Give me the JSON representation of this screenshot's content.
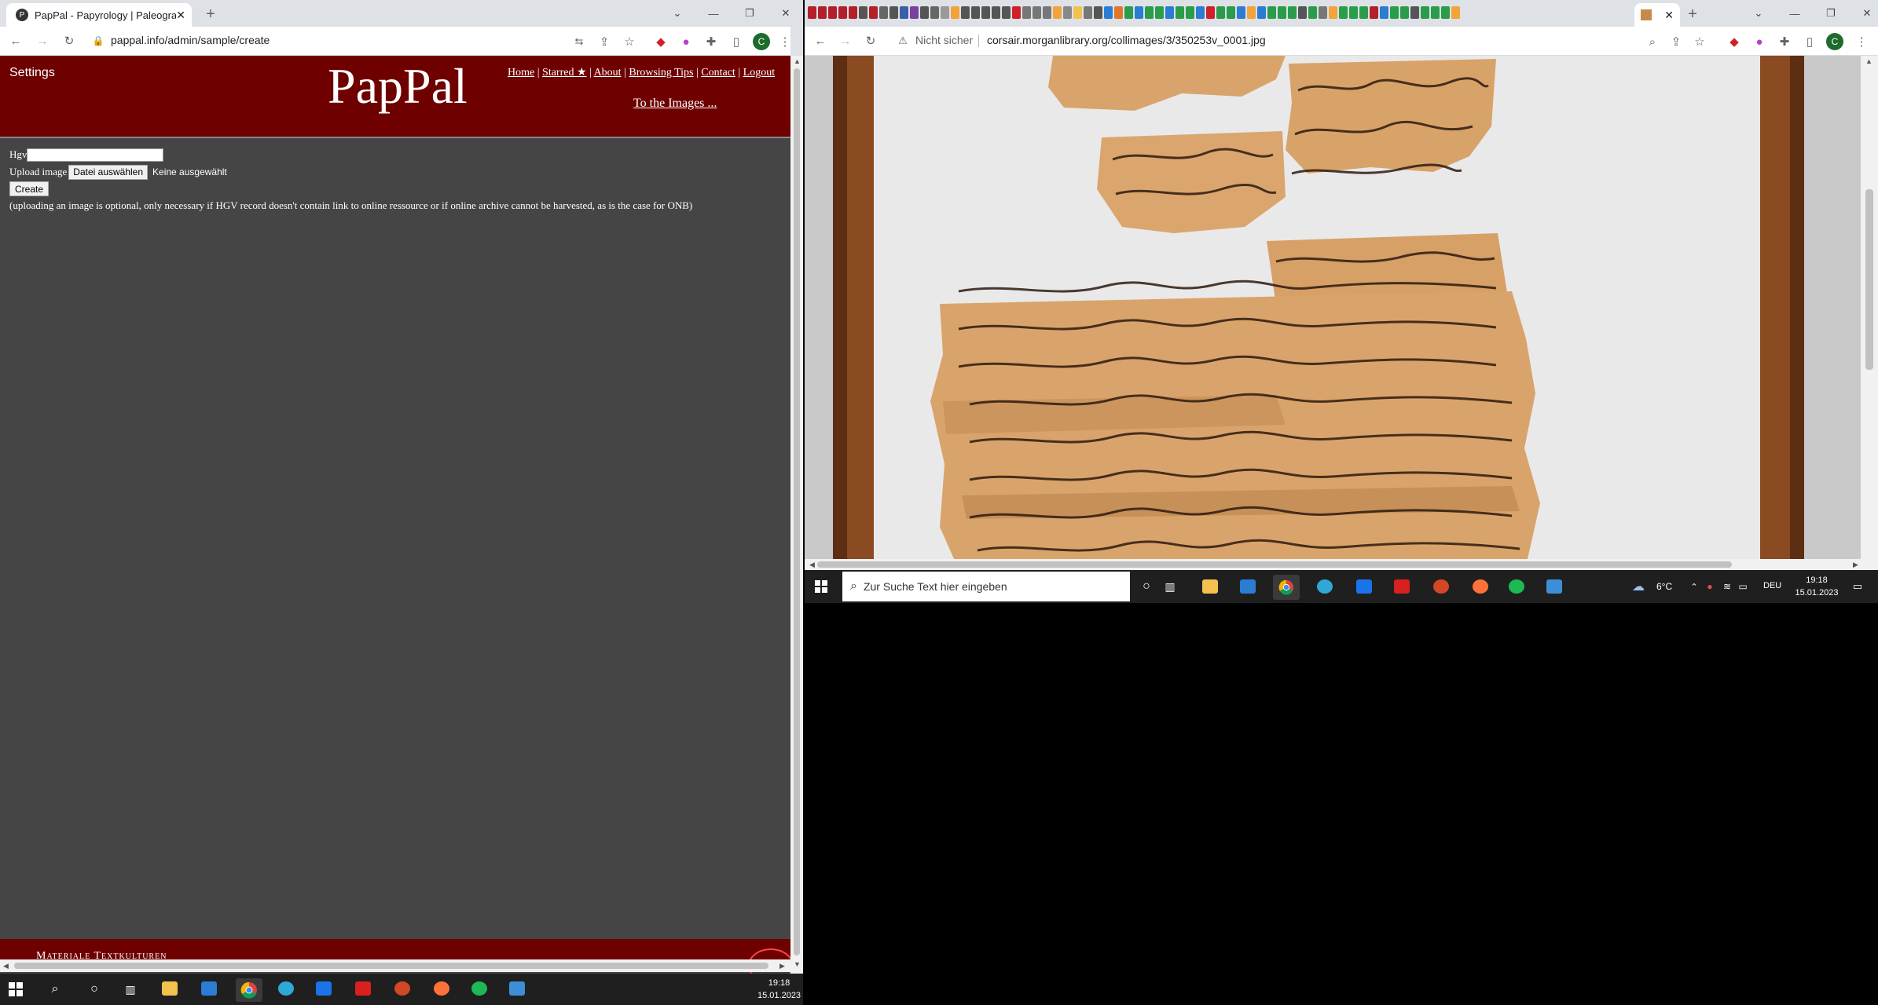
{
  "left_browser": {
    "tab_title": "PapPal - Papyrology | Paleography",
    "new_tab": "+",
    "url": "pappal.info/admin/sample/create",
    "profile_initial": "C",
    "site": {
      "settings": "Settings",
      "logo": "PapPal",
      "nav": [
        "Home",
        "Starred ★",
        "About",
        "Browsing Tips",
        "Contact",
        "Logout"
      ],
      "nav_sep": "|",
      "to_images": "To the Images ...",
      "form": {
        "hgv_label": "Hgv",
        "hgv_value": "",
        "upload_label": "Upload image",
        "file_button": "Datei auswählen",
        "file_status": "Keine ausgewählt",
        "create_button": "Create",
        "note": "(uploading an image is optional, only necessary if HGV record doesn't contain link to online ressource or if online archive cannot be harvested, as is the case for ONB)"
      },
      "footer": "Materiale Textkulturen"
    },
    "taskbar": {
      "time": "19:18",
      "date": "15.01.2023"
    }
  },
  "right_browser": {
    "security": "Nicht sicher",
    "url": "corsair.morganlibrary.org/collimages/3/350253v_0001.jpg",
    "new_tab": "+",
    "profile_initial": "C",
    "taskbar": {
      "search_placeholder": "Zur Suche Text hier eingeben",
      "weather": "6°C",
      "lang": "DEU",
      "time": "19:18",
      "date": "15.01.2023"
    }
  },
  "colors": {
    "pappal_red": "#6e0000",
    "page_gray": "#454545",
    "papyrus": "#d9a46b",
    "ink": "#2d1a0e"
  }
}
